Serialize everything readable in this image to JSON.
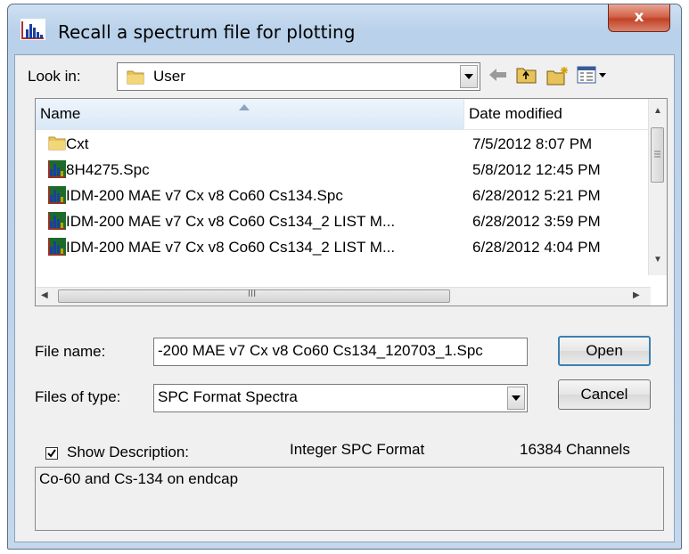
{
  "window": {
    "title": "Recall a spectrum file for plotting",
    "close_label": "x"
  },
  "look_in": {
    "label": "Look in:",
    "value": "User"
  },
  "file_list": {
    "columns": [
      "Name",
      "Date modified"
    ],
    "rows": [
      {
        "name": "Cxt",
        "date": "7/5/2012 8:07 PM",
        "icon": "folder-icon"
      },
      {
        "name": "8H4275.Spc",
        "date": "5/8/2012 12:45 PM",
        "icon": "spectrum-file-icon"
      },
      {
        "name": "IDM-200 MAE v7 Cx v8 Co60 Cs134.Spc",
        "date": "6/28/2012 5:21 PM",
        "icon": "spectrum-file-icon"
      },
      {
        "name": "IDM-200 MAE v7 Cx v8 Co60 Cs134_2 LIST M...",
        "date": "6/28/2012 3:59 PM",
        "icon": "spectrum-file-icon"
      },
      {
        "name": "IDM-200 MAE v7 Cx v8 Co60 Cs134_2 LIST M...",
        "date": "6/28/2012 4:04 PM",
        "icon": "spectrum-file-icon"
      }
    ],
    "hscroll_glyph": "III"
  },
  "file_name": {
    "label": "File name:",
    "value": "-200 MAE v7 Cx v8 Co60 Cs134_120703_1.Spc"
  },
  "file_type": {
    "label": "Files of type:",
    "value": "SPC Format Spectra"
  },
  "buttons": {
    "open": "Open",
    "cancel": "Cancel"
  },
  "description": {
    "show_label": "Show Description:",
    "checked": true,
    "format": "Integer SPC Format",
    "channels": "16384 Channels",
    "text": "Co-60 and Cs-134 on endcap"
  }
}
